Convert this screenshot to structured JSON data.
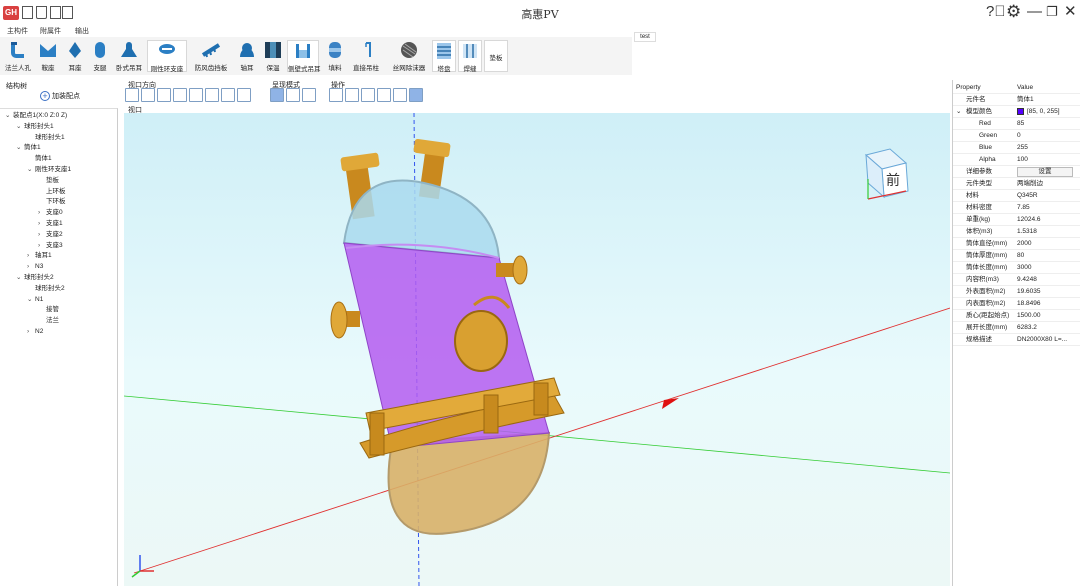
{
  "app": {
    "title": "高惠PV",
    "logo_text": "GH"
  },
  "menu": [
    {
      "label": "主构件",
      "active": false
    },
    {
      "label": "附属件",
      "active": true
    },
    {
      "label": "输出",
      "active": false
    }
  ],
  "ribbon": {
    "tools": [
      {
        "label": "法兰人孔",
        "icon": "flange-manhole-icon"
      },
      {
        "label": "鞍座",
        "icon": "saddle-icon"
      },
      {
        "label": "耳座",
        "icon": "lug-icon"
      },
      {
        "label": "支腿",
        "icon": "support-leg-icon"
      },
      {
        "label": "卧式吊耳",
        "icon": "horizontal-lifting-lug-icon"
      },
      {
        "label": "刚性环支座",
        "icon": "rigid-ring-support-icon"
      },
      {
        "label": "防风齿挡板",
        "icon": "wind-baffle-icon"
      },
      {
        "label": "轴耳",
        "icon": "trunnion-icon"
      },
      {
        "label": "保温",
        "icon": "insulation-icon"
      },
      {
        "label": "侧壁式吊耳",
        "icon": "side-lifting-lug-icon"
      },
      {
        "label": "填料",
        "icon": "packing-icon"
      },
      {
        "label": "直接吊柱",
        "icon": "davit-icon"
      },
      {
        "label": "丝网除沫器",
        "icon": "demister-icon"
      },
      {
        "label": "塔盘",
        "icon": "tray-icon"
      },
      {
        "label": "焊缝",
        "icon": "weld-icon"
      },
      {
        "label": "垫板",
        "icon": "pad-icon"
      }
    ],
    "test_tag": "test"
  },
  "left_panel": {
    "title": "结构树",
    "add_node_label": "加装配点",
    "tree": [
      {
        "label": "装配点1(X:0 Z:0 Z)",
        "toggle": "v",
        "level": 0
      },
      {
        "label": "球形封头1",
        "toggle": "v",
        "level": 1
      },
      {
        "label": "球形封头1",
        "toggle": "",
        "level": 2
      },
      {
        "label": "筒体1",
        "toggle": "v",
        "level": 1
      },
      {
        "label": "筒体1",
        "toggle": "",
        "level": 2
      },
      {
        "label": "刚性环支座1",
        "toggle": "v",
        "level": 2
      },
      {
        "label": "垫板",
        "toggle": "",
        "level": 3
      },
      {
        "label": "上环板",
        "toggle": "",
        "level": 3
      },
      {
        "label": "下环板",
        "toggle": "",
        "level": 3
      },
      {
        "label": "支座0",
        "toggle": ">",
        "level": 3
      },
      {
        "label": "支座1",
        "toggle": ">",
        "level": 3
      },
      {
        "label": "支座2",
        "toggle": ">",
        "level": 3
      },
      {
        "label": "支座3",
        "toggle": ">",
        "level": 3
      },
      {
        "label": "轴耳1",
        "toggle": ">",
        "level": 2
      },
      {
        "label": "N3",
        "toggle": ">",
        "level": 2
      },
      {
        "label": "球形封头2",
        "toggle": "v",
        "level": 1
      },
      {
        "label": "球形封头2",
        "toggle": "",
        "level": 2
      },
      {
        "label": "N1",
        "toggle": "v",
        "level": 2
      },
      {
        "label": "接管",
        "toggle": "",
        "level": 3
      },
      {
        "label": "法兰",
        "toggle": "",
        "level": 3
      },
      {
        "label": "N2",
        "toggle": ">",
        "level": 2
      }
    ]
  },
  "viewport_toolbar": {
    "groups": [
      {
        "label": "视口方向",
        "buttons": [
          "iso-view-icon",
          "front-view-icon",
          "back-view-icon",
          "left-view-icon",
          "right-view-icon",
          "top-view-icon",
          "bottom-view-icon",
          "perspective-cube-icon"
        ]
      },
      {
        "label": "呈现模式",
        "buttons": [
          "shaded-mode-icon",
          "wireframe-mode-icon",
          "transparent-mode-icon"
        ]
      },
      {
        "label": "操作",
        "buttons": [
          "delete-icon",
          "copy-icon",
          "mirror-icon",
          "visibility-icon",
          "measure-icon",
          "section-icon"
        ]
      }
    ]
  },
  "viewport": {
    "label": "视口",
    "viewcube_label": "前",
    "colors": {
      "shell": "#5500ff",
      "steel": "#d69a2a"
    }
  },
  "properties": {
    "header": {
      "key": "Property",
      "value": "Value"
    },
    "rows": [
      {
        "key": "元件名",
        "value": "筒体1",
        "type": "plain"
      },
      {
        "key": "模型颜色",
        "value": "[85, 0, 255]",
        "type": "color",
        "toggle": "v"
      },
      {
        "key": "Red",
        "value": "85",
        "type": "sub"
      },
      {
        "key": "Green",
        "value": "0",
        "type": "sub"
      },
      {
        "key": "Blue",
        "value": "255",
        "type": "sub"
      },
      {
        "key": "Alpha",
        "value": "100",
        "type": "sub"
      },
      {
        "key": "详细参数",
        "value": "设置",
        "type": "button"
      },
      {
        "key": "元件类型",
        "value": "两端削边",
        "type": "plain"
      },
      {
        "key": "材料",
        "value": "Q345R",
        "type": "plain"
      },
      {
        "key": "材料密度",
        "value": "7.85",
        "type": "plain"
      },
      {
        "key": "单重(kg)",
        "value": "12024.6",
        "type": "plain"
      },
      {
        "key": "体积(m3)",
        "value": "1.5318",
        "type": "plain"
      },
      {
        "key": "筒体直径(mm)",
        "value": "2000",
        "type": "plain"
      },
      {
        "key": "筒体厚度(mm)",
        "value": "80",
        "type": "plain"
      },
      {
        "key": "筒体长度(mm)",
        "value": "3000",
        "type": "plain"
      },
      {
        "key": "内容积(m3)",
        "value": "9.4248",
        "type": "plain"
      },
      {
        "key": "外表面积(m2)",
        "value": "19.6035",
        "type": "plain"
      },
      {
        "key": "内表面积(m2)",
        "value": "18.8496",
        "type": "plain"
      },
      {
        "key": "质心(距起始点)",
        "value": "1500.00",
        "type": "plain"
      },
      {
        "key": "展开长度(mm)",
        "value": "6283.2",
        "type": "plain"
      },
      {
        "key": "规格描述",
        "value": "DN2000X80 L=...",
        "type": "plain"
      }
    ]
  }
}
